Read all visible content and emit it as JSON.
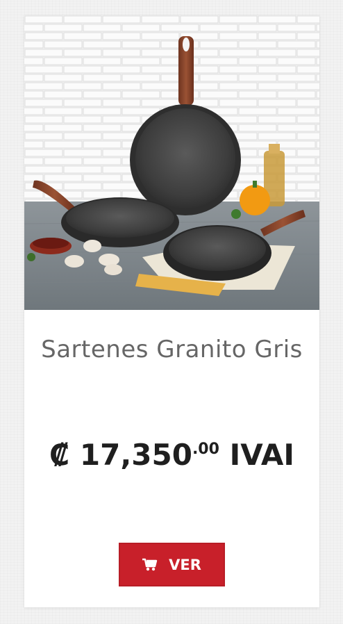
{
  "product": {
    "title": "Sartenes Granito Gris",
    "currency_symbol": "₡",
    "price_whole": "17,350",
    "price_decimal": ".00",
    "tax_label": "IVAI",
    "button_label": "VER",
    "button_icon": "shopping-cart-icon"
  },
  "colors": {
    "accent": "#c8202a",
    "title_text": "#666666",
    "price_text": "#1f1f1f"
  }
}
